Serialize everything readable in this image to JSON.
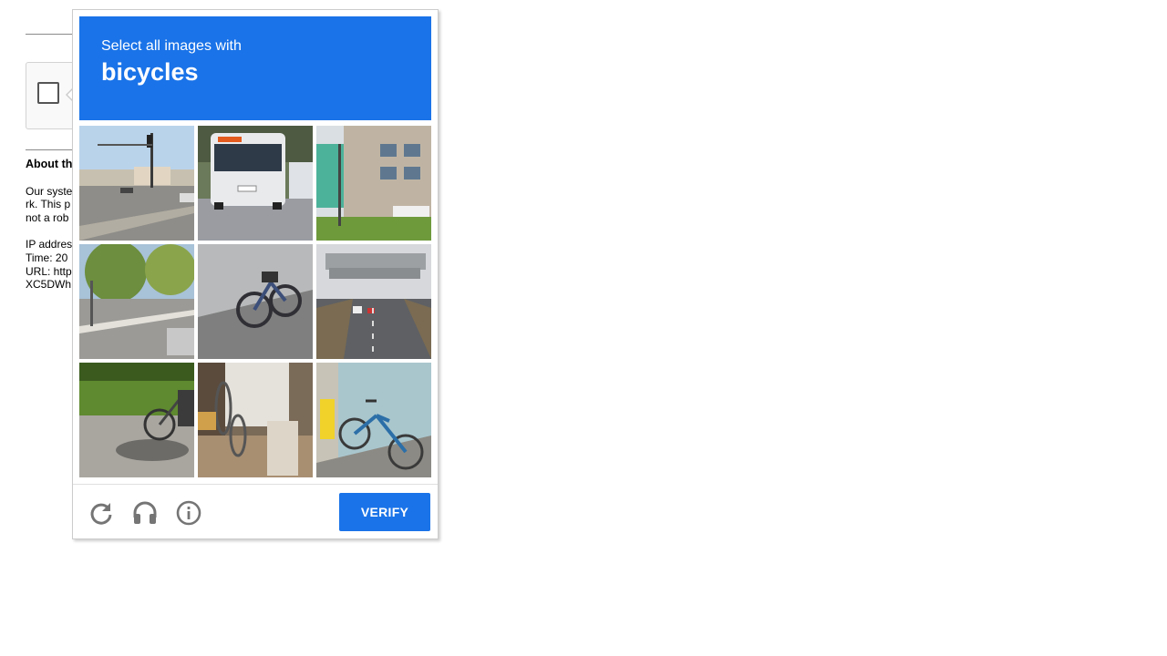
{
  "background": {
    "about_heading": "About th",
    "paragraph_lines": [
      "Our syste",
      "rk. This p",
      "not a rob"
    ],
    "info_lines": [
      "IP addres",
      "Time: 20",
      "URL: http",
      "XC5DWh"
    ]
  },
  "challenge": {
    "instruction": "Select all images with",
    "target": "bicycles",
    "tiles": [
      {
        "label": "intersection"
      },
      {
        "label": "bus"
      },
      {
        "label": "building-street"
      },
      {
        "label": "street-trees"
      },
      {
        "label": "bicycle-wall"
      },
      {
        "label": "highway"
      },
      {
        "label": "bicycle-grass"
      },
      {
        "label": "bicycle-shop"
      },
      {
        "label": "bicycle-blue"
      }
    ]
  },
  "footer": {
    "verify_label": "VERIFY",
    "icons": [
      "reload-icon",
      "audio-icon",
      "info-icon"
    ]
  },
  "colors": {
    "accent": "#1a73e8",
    "icon_gray": "#757575"
  }
}
